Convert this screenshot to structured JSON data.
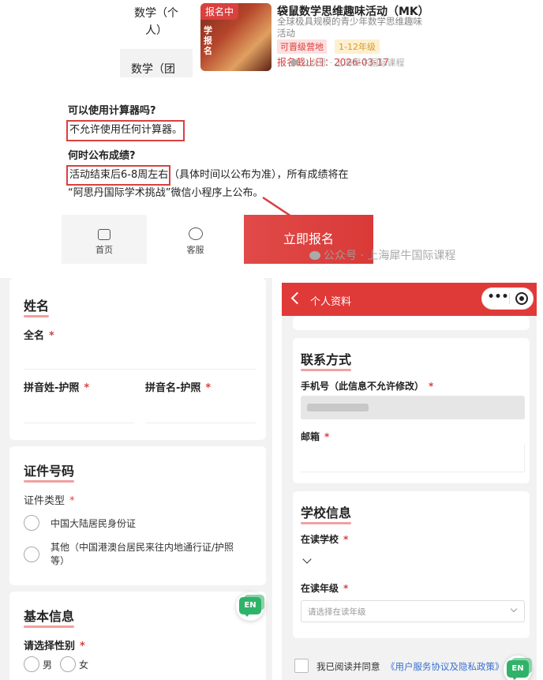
{
  "top_card": {
    "categories": [
      "数学（个人）",
      "数学（团"
    ],
    "status_badge": "报名中",
    "title": "袋鼠数学思维趣味活动（MK）",
    "subtitle": "全球极具规模的青少年数学思维趣味活动",
    "tag_upgrade": "可晋级营地",
    "tag_grade": "1-12年级",
    "deadline": "报名截止日：2026-03-17",
    "watermark": "公众号 · 上海犀牛国际课程"
  },
  "faq": {
    "q1": "可以使用计算器吗?",
    "a1": "不允许使用任何计算器。",
    "q2": "何时公布成绩?",
    "a2_highlight": "活动结束后6-8周左右",
    "a2_rest": "（具体时间以公布为准），所有成绩将在",
    "a2_line2": "“阿思丹国际学术挑战”微信小程序上公布。"
  },
  "bottom_bar": {
    "home": "首页",
    "service": "客服",
    "register": "立即报名",
    "watermark": "公众号 · 上海犀牛国际课程"
  },
  "left_form": {
    "name_section": "姓名",
    "full_name": "全名",
    "pinyin_last": "拼音姓-护照",
    "pinyin_first": "拼音名-护照",
    "id_section": "证件号码",
    "id_type": "证件类型",
    "id_opt1": "中国大陆居民身份证",
    "id_opt2_line1": "其他（中国港澳台居民来往内地通行证/护照",
    "id_opt2_line2": "等）",
    "basic_section": "基本信息",
    "gender_label": "请选择性别",
    "male": "男",
    "female": "女",
    "en_label": "EN"
  },
  "right_form": {
    "header_title": "个人资料",
    "contact_section": "联系方式",
    "phone_label": "手机号（此信息不允许修改）",
    "email_label": "邮箱",
    "school_section": "学校信息",
    "school_label": "在读学校",
    "grade_label": "在读年级",
    "grade_placeholder": "请选择在读年级",
    "agree_text": "我已阅读并同意",
    "agree_link": "《用户服务协议及隐私政策》",
    "en_label": "EN"
  },
  "colors": {
    "brand_red": "#d9403e",
    "header_red": "#e03a38"
  }
}
